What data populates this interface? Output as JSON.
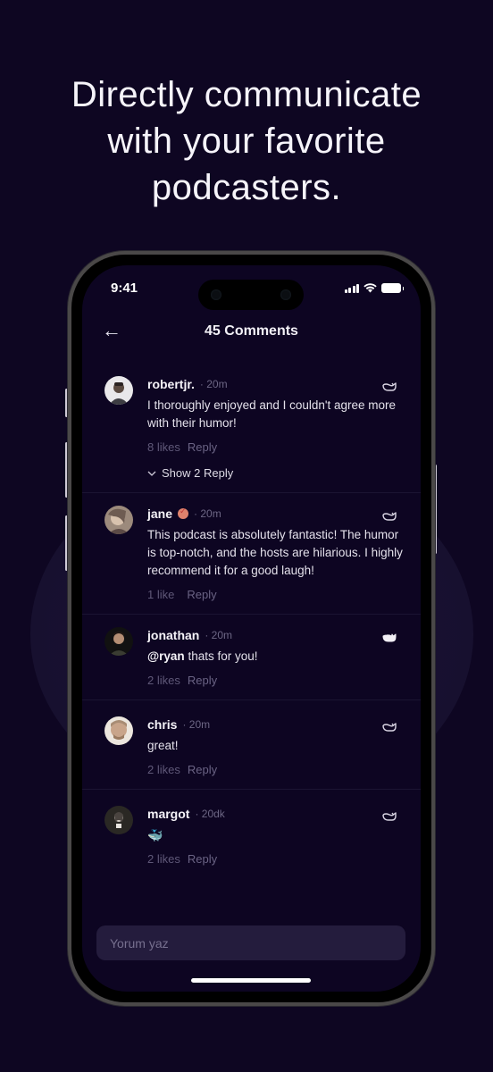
{
  "headline": [
    "Directly communicate",
    "with your favorite",
    "podcasters."
  ],
  "status_bar": {
    "time": "9:41",
    "icons": [
      "cellular-signal-icon",
      "wifi-icon",
      "battery-icon"
    ]
  },
  "nav": {
    "back_icon": "←",
    "title": "45 Comments"
  },
  "comments": [
    {
      "name": "robertjr.",
      "verified": false,
      "time": "· 20m",
      "text": "I thoroughly enjoyed  and I couldn't agree more with their humor!",
      "likes": "8 likes",
      "reply": "Reply",
      "liked": false,
      "show_replies": "Show 2 Reply"
    },
    {
      "name": "jane",
      "verified": true,
      "time": "· 20m",
      "text": "This  podcast is absolutely fantastic! The humor is top-notch, and the hosts are hilarious. I highly recommend it for a good laugh!",
      "likes": "1 like",
      "reply": "Reply",
      "liked": false
    },
    {
      "name": "jonathan",
      "verified": false,
      "time": "· 20m",
      "mention": "@ryan",
      "text": " thats for you!",
      "likes": "2 likes",
      "reply": "Reply",
      "liked": true
    },
    {
      "name": "chris",
      "verified": false,
      "time": "· 20m",
      "text": "great!",
      "likes": "2 likes",
      "reply": "Reply",
      "liked": false
    },
    {
      "name": "margot",
      "verified": false,
      "time": "· 20dk",
      "text": "🐳",
      "likes": "2 likes",
      "reply": "Reply",
      "liked": false
    }
  ],
  "input": {
    "placeholder": "Yorum yaz",
    "value": ""
  },
  "colors": {
    "background": "#0e0622",
    "screen": "#0d0522",
    "input_bg": "#241c3d",
    "muted_text": "#5f5878",
    "verified_badge": "#e0826d"
  }
}
